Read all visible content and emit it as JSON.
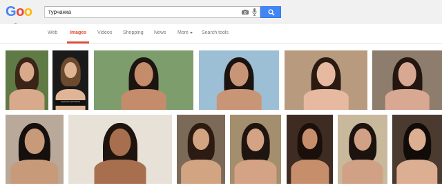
{
  "logo": {
    "text": "Google",
    "letters": [
      "G",
      "o",
      "o",
      "g",
      "l",
      "e"
    ],
    "colors": [
      "#4285f4",
      "#ea4335",
      "#fbbc05",
      "#4285f4",
      "#34a853",
      "#ea4335"
    ]
  },
  "search": {
    "query": "турчанка",
    "accent": "#4285f4"
  },
  "icons": {
    "camera": "camera-icon",
    "mic": "mic-icon",
    "search": "search-icon"
  },
  "nav": {
    "items": [
      {
        "label": "Web",
        "active": false
      },
      {
        "label": "Images",
        "active": true
      },
      {
        "label": "Videos",
        "active": false
      },
      {
        "label": "Shopping",
        "active": false
      },
      {
        "label": "News",
        "active": false
      },
      {
        "label": "More",
        "active": false
      },
      {
        "label": "Search tools",
        "active": false
      }
    ],
    "active_color": "#dd4b39"
  },
  "results": {
    "row1": [
      {
        "name": "image-result-1",
        "bg": "#5f7a45",
        "skin": "#d8a98a",
        "hair": "#3a2418"
      },
      {
        "name": "image-result-2",
        "bg": "#1a1a1a",
        "skin": "#e0b596",
        "hair": "#6b4a2e",
        "caption": "Турецкая красавица"
      },
      {
        "name": "image-result-3",
        "bg": "#7d9d6d",
        "skin": "#c48c6a",
        "hair": "#1c1410"
      },
      {
        "name": "image-result-4",
        "bg": "#9dbfd6",
        "skin": "#c99577",
        "hair": "#1b130f"
      },
      {
        "name": "image-result-5",
        "bg": "#b89a7f",
        "skin": "#e6b9a0",
        "hair": "#2a1a12"
      },
      {
        "name": "image-result-6",
        "bg": "#8e7c6c",
        "skin": "#d9a892",
        "hair": "#231610"
      }
    ],
    "row2": [
      {
        "name": "image-result-7",
        "bg": "#b8a99a",
        "skin": "#c79a7a",
        "hair": "#15100d"
      },
      {
        "name": "image-result-8",
        "bg": "#e8e1d7",
        "skin": "#a86f4e",
        "hair": "#1e130d"
      },
      {
        "name": "image-result-9",
        "bg": "#7b6a58",
        "skin": "#d2a482",
        "hair": "#2b1b12"
      },
      {
        "name": "image-result-10",
        "bg": "#a38e6e",
        "skin": "#d4a284",
        "hair": "#1f1510"
      },
      {
        "name": "image-result-11",
        "bg": "#3e2c22",
        "skin": "#c78e6c",
        "hair": "#1a0f0a"
      },
      {
        "name": "image-result-12",
        "bg": "#c8b89c",
        "skin": "#d0a184",
        "hair": "#1d130e"
      },
      {
        "name": "image-result-13",
        "bg": "#4a3a30",
        "skin": "#dcae92",
        "hair": "#120c09"
      }
    ]
  }
}
